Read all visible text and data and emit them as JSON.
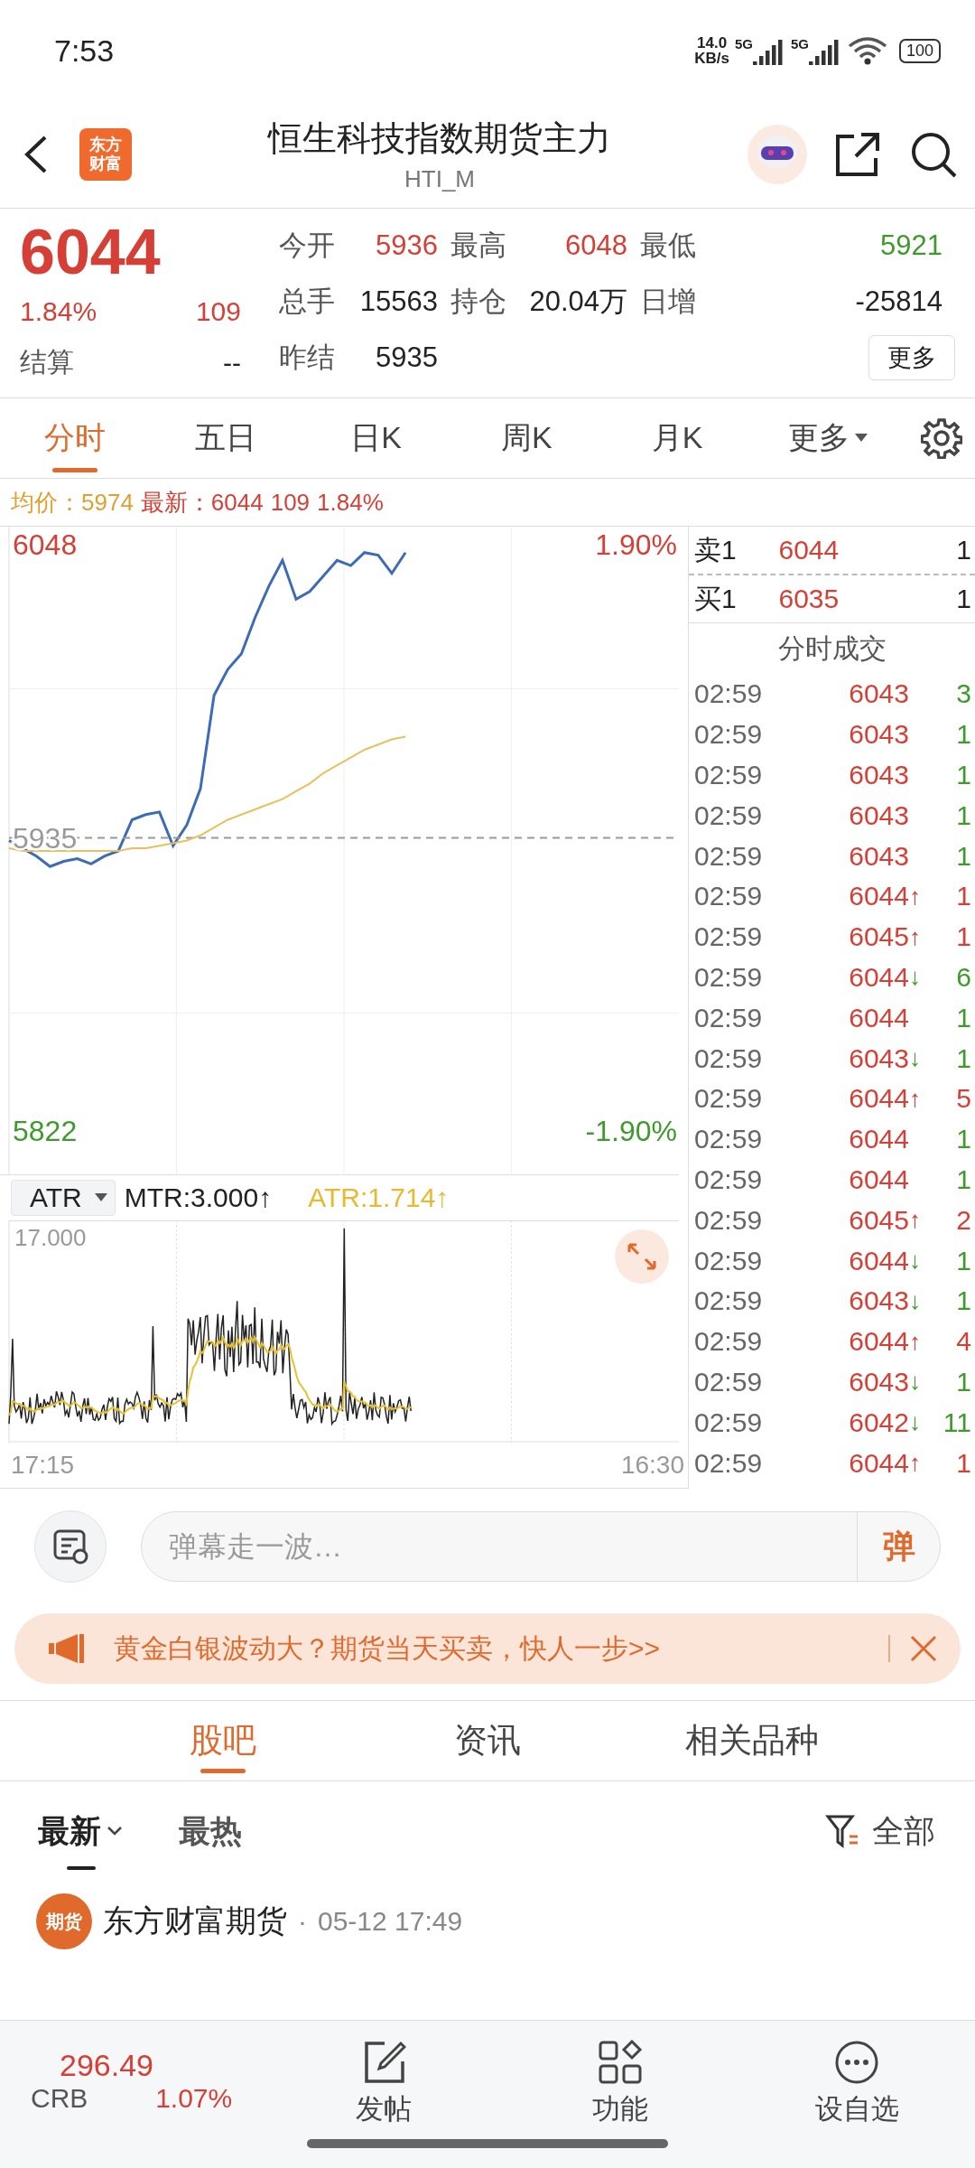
{
  "status_bar": {
    "time": "7:53",
    "speed_value": "14.0",
    "speed_unit": "KB/s",
    "networks": [
      "5G",
      "5G"
    ],
    "battery": "100"
  },
  "header": {
    "logo": [
      "东方",
      "财富"
    ],
    "title": "恒生科技指数期货主力",
    "code": "HTI_M"
  },
  "quote": {
    "price": "6044",
    "change_pct": "1.84%",
    "change": "109",
    "settle_label": "结算",
    "settle": "--",
    "fields": [
      {
        "label": "今开",
        "value": "5936",
        "color": "#d63f35"
      },
      {
        "label": "最高",
        "value": "6048",
        "color": "#d63f35"
      },
      {
        "label": "最低",
        "value": "5921",
        "color": "#3e9a2c"
      },
      {
        "label": "总手",
        "value": "15563",
        "color": "#222222"
      },
      {
        "label": "持仓",
        "value": "20.04万",
        "color": "#222222"
      },
      {
        "label": "日增",
        "value": "-25814",
        "color": "#222222"
      },
      {
        "label": "昨结",
        "value": "5935",
        "color": "#222222"
      }
    ],
    "more_button": "更多"
  },
  "period_tabs": [
    {
      "label": "分时",
      "selected": true,
      "kind": "tab"
    },
    {
      "label": "五日",
      "selected": false,
      "kind": "tab"
    },
    {
      "label": "日K",
      "selected": false,
      "kind": "tab"
    },
    {
      "label": "周K",
      "selected": false,
      "kind": "tab"
    },
    {
      "label": "月K",
      "selected": false,
      "kind": "tab"
    },
    {
      "label": "更多",
      "selected": false,
      "kind": "dropdown"
    }
  ],
  "info_line": {
    "avg_label": "均价：",
    "avg": "5974",
    "last_label": "最新：",
    "last": "6044",
    "change": "109",
    "change_pct": "1.84%"
  },
  "price_chart": {
    "right_labels": [
      {
        "text": "1.90%",
        "color": "#d63f35"
      },
      {
        "text": "-1.90%",
        "color": "#3e9a2c"
      }
    ],
    "chart_data": {
      "type": "line",
      "categories": [
        null,
        null,
        null,
        null,
        null,
        null,
        null,
        null,
        null,
        null,
        null,
        null,
        null,
        null,
        null,
        null,
        null,
        null,
        null,
        null,
        null,
        null,
        null,
        null,
        null,
        null,
        null,
        null,
        null,
        null,
        null,
        null,
        null,
        null,
        null,
        null,
        null,
        null,
        null,
        null,
        null,
        null,
        null,
        null,
        null,
        null,
        null,
        null,
        null,
        null
      ],
      "ylim": [
        5805,
        6055
      ],
      "yticks": [
        {
          "value": 6048,
          "label": "6048"
        },
        {
          "value": 5935,
          "label": "5935"
        },
        {
          "value": 5822,
          "label": "5822"
        }
      ],
      "series": [
        {
          "color": "#3d6bb8",
          "values": [
            5934,
            5931,
            5928,
            5924,
            5926,
            5927,
            5925,
            5928,
            5930,
            5942,
            5944,
            5945,
            5932,
            5940,
            5954,
            5990,
            6000,
            6006,
            6020,
            6032,
            6042,
            6027,
            6030,
            6036,
            6042,
            6040,
            6045,
            6044,
            6037,
            6045,
            null,
            null,
            null,
            null,
            null,
            null,
            null,
            null,
            null,
            null,
            null,
            null,
            null,
            null,
            null,
            null,
            null,
            null,
            null,
            null
          ]
        },
        {
          "color": "#999999",
          "line_style": "dashed",
          "values": [
            5935,
            5935,
            5935,
            5935,
            5935,
            5935,
            5935,
            5935,
            5935,
            5935,
            5935,
            5935,
            5935,
            5935,
            5935,
            5935,
            5935,
            5935,
            5935,
            5935,
            5935,
            5935,
            5935,
            5935,
            5935,
            5935,
            5935,
            5935,
            5935,
            5935,
            5935,
            5935,
            5935,
            5935,
            5935,
            5935,
            5935,
            5935,
            5935,
            5935,
            5935,
            5935,
            5935,
            5935,
            5935,
            5935,
            5935,
            5935,
            5935,
            5935
          ]
        },
        {
          "color": "#e8c060",
          "values": [
            5931,
            5930,
            5930,
            5930,
            5930,
            5930,
            5930,
            5930,
            5930,
            5931,
            5931,
            5932,
            5933,
            5934,
            5936,
            5939,
            5942,
            5944,
            5946,
            5948,
            5950,
            5953,
            5956,
            5960,
            5963,
            5966,
            5969,
            5971,
            5973,
            5974,
            null,
            null,
            null,
            null,
            null,
            null,
            null,
            null,
            null,
            null,
            null,
            null,
            null,
            null,
            null,
            null,
            null,
            null,
            null,
            null
          ]
        }
      ]
    }
  },
  "order_book": [
    {
      "label": "卖1",
      "price": "6044",
      "volume": "1"
    },
    {
      "label": "买1",
      "price": "6035",
      "volume": "1"
    }
  ],
  "trades_title": "分时成交",
  "trades": [
    {
      "time": "02:59",
      "price": "6043",
      "volume": "3",
      "color": "#3e9a2c"
    },
    {
      "time": "02:59",
      "price": "6043",
      "volume": "1",
      "color": "#3e9a2c"
    },
    {
      "time": "02:59",
      "price": "6043",
      "volume": "1",
      "color": "#3e9a2c"
    },
    {
      "time": "02:59",
      "price": "6043",
      "volume": "1",
      "color": "#3e9a2c"
    },
    {
      "time": "02:59",
      "price": "6043",
      "volume": "1",
      "color": "#3e9a2c"
    },
    {
      "time": "02:59",
      "price": "6044",
      "arrow": "↑",
      "volume": "1",
      "color": "#d63f35"
    },
    {
      "time": "02:59",
      "price": "6045",
      "arrow": "↑",
      "volume": "1",
      "color": "#d63f35"
    },
    {
      "time": "02:59",
      "price": "6044",
      "arrow": "↓",
      "volume": "6",
      "color": "#3e9a2c"
    },
    {
      "time": "02:59",
      "price": "6044",
      "volume": "1",
      "color": "#3e9a2c"
    },
    {
      "time": "02:59",
      "price": "6043",
      "arrow": "↓",
      "volume": "1",
      "color": "#3e9a2c"
    },
    {
      "time": "02:59",
      "price": "6044",
      "arrow": "↑",
      "volume": "5",
      "color": "#d63f35"
    },
    {
      "time": "02:59",
      "price": "6044",
      "volume": "1",
      "color": "#3e9a2c"
    },
    {
      "time": "02:59",
      "price": "6044",
      "volume": "1",
      "color": "#3e9a2c"
    },
    {
      "time": "02:59",
      "price": "6045",
      "arrow": "↑",
      "volume": "2",
      "color": "#d63f35"
    },
    {
      "time": "02:59",
      "price": "6044",
      "arrow": "↓",
      "volume": "1",
      "color": "#3e9a2c"
    },
    {
      "time": "02:59",
      "price": "6043",
      "arrow": "↓",
      "volume": "1",
      "color": "#3e9a2c"
    },
    {
      "time": "02:59",
      "price": "6044",
      "arrow": "↑",
      "volume": "4",
      "color": "#d63f35"
    },
    {
      "time": "02:59",
      "price": "6043",
      "arrow": "↓",
      "volume": "1",
      "color": "#3e9a2c"
    },
    {
      "time": "02:59",
      "price": "6042",
      "arrow": "↓",
      "volume": "11",
      "color": "#3e9a2c"
    },
    {
      "time": "02:59",
      "price": "6044",
      "arrow": "↑",
      "volume": "1",
      "color": "#d63f35"
    }
  ],
  "indicator": {
    "name": "ATR",
    "mtr": "MTR:3.000",
    "mtr_arrow": "↑",
    "atr": "ATR:1.714",
    "atr_arrow": "↑",
    "max_label": "17.000",
    "start_time": "17:15",
    "end_time": "16:30"
  },
  "danmu": {
    "placeholder": "弹幕走一波…",
    "send": "弹"
  },
  "ad": {
    "text": "黄金白银波动大？期货当天买卖，快人一步>>"
  },
  "section_tabs": [
    {
      "label": "股吧",
      "selected": true
    },
    {
      "label": "资讯",
      "selected": false
    },
    {
      "label": "相关品种",
      "selected": false
    }
  ],
  "sort_tabs": [
    {
      "label": "最新",
      "selected": true,
      "kind": "dropdown"
    },
    {
      "label": "最热",
      "selected": false,
      "kind": "tab"
    }
  ],
  "filter": "全部",
  "post": {
    "avatar_text": "期货",
    "author": "东方财富期货",
    "separator": "·",
    "time": "05-12 17:49"
  },
  "bottom_bar": {
    "ticker": {
      "value": "296.49",
      "name": "CRB",
      "change_pct": "1.07%"
    },
    "actions": [
      {
        "label": "发帖",
        "kind": "post"
      },
      {
        "label": "功能",
        "kind": "apps"
      },
      {
        "label": "设自选",
        "kind": "more"
      }
    ]
  }
}
